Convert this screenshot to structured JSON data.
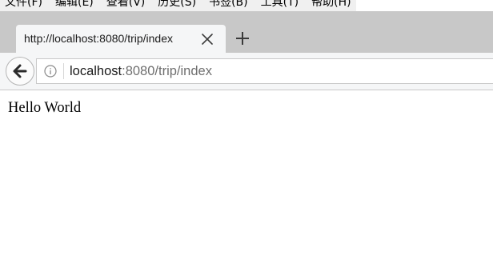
{
  "menubar": {
    "items": [
      {
        "label": "文件(F)"
      },
      {
        "label": "编辑(E)"
      },
      {
        "label": "查看(V)"
      },
      {
        "label": "历史(S)"
      },
      {
        "label": "书签(B)"
      },
      {
        "label": "工具(T)"
      },
      {
        "label": "帮助(H)"
      }
    ]
  },
  "tab": {
    "title": "http://localhost:8080/trip/index",
    "close_icon": "close-icon"
  },
  "newtab": {
    "icon": "plus-icon"
  },
  "navbar": {
    "back_icon": "back-arrow-icon",
    "info_icon": "info-icon",
    "url_host": "localhost",
    "url_rest": ":8080/trip/index"
  },
  "page": {
    "text": "Hello World"
  },
  "colors": {
    "tabstrip": "#c8c8c8",
    "toolbar": "#f5f6f7",
    "url_muted": "#6f6f6f"
  }
}
